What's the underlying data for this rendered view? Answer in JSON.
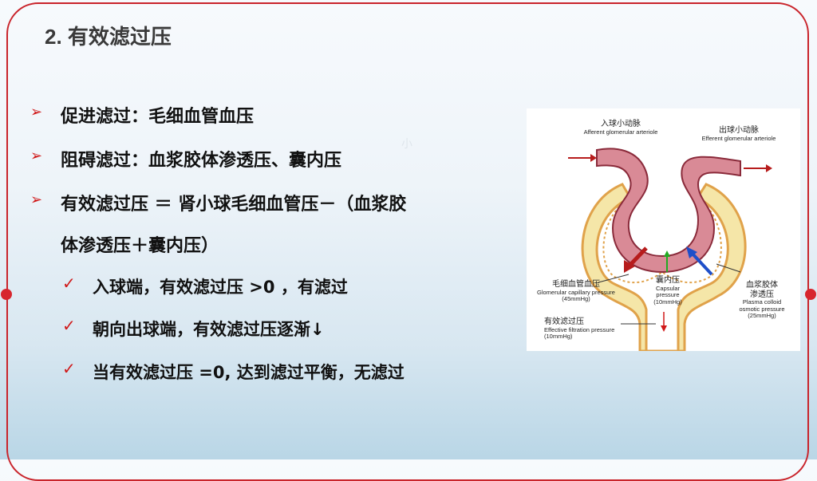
{
  "title": "2. 有效滤过压",
  "bullets": [
    {
      "label": "促进滤过：毛细血管血压"
    },
    {
      "label": "阻碍滤过：血浆胶体渗透压、囊内压"
    },
    {
      "label": "有效滤过压 ＝ 肾小球毛细血管压－（血浆胶",
      "continuation": "体渗透压＋囊内压）"
    }
  ],
  "sub_bullets": [
    "入球端，有效滤过压 >0 ，有滤过",
    "朝向出球端，有效滤过压逐渐↓",
    "当有效滤过压 =0, 达到滤过平衡，无滤过"
  ],
  "faint_char": "小",
  "diagram": {
    "afferent_zh": "入球小动脉",
    "afferent_en": "Afferent glomerular arteriole",
    "efferent_zh": "出球小动脉",
    "efferent_en": "Efferent glomerular arteriole",
    "capillary_zh": "毛细血管血压",
    "capillary_en": "Glomerular capillary pressure",
    "capillary_val": "(45mmHg)",
    "capsular_zh": "囊内压",
    "capsular_en1": "Capsular",
    "capsular_en2": "pressure",
    "capsular_val": "(10mmHg)",
    "oncotic_zh1": "血浆胶体",
    "oncotic_zh2": "渗透压",
    "oncotic_en1": "Plasma colloid",
    "oncotic_en2": "osmotic pressure",
    "oncotic_val": "(25mmHg)",
    "eff_zh": "有效滤过压",
    "eff_en": "Effective filtration pressure",
    "eff_val": "(10mmHg)"
  },
  "colors": {
    "accent": "#c9242b",
    "capillary": "#d98a96",
    "capsule": "#f5e6a8",
    "arrow_red": "#b71c1c",
    "arrow_blue": "#1e4fc9",
    "arrow_green": "#22aa22"
  }
}
